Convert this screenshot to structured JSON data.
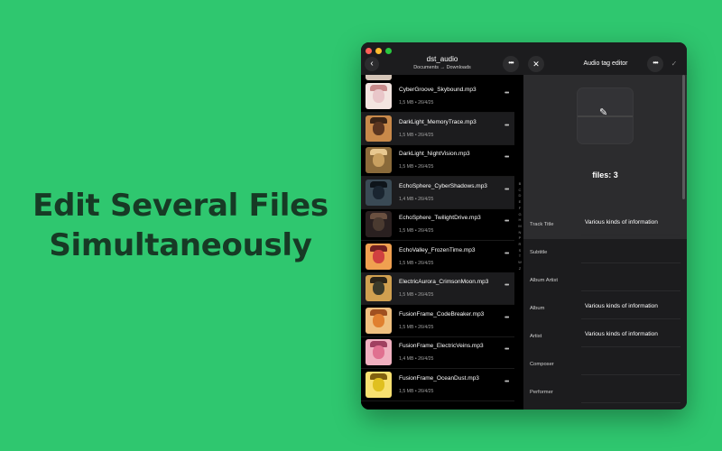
{
  "headline": {
    "line1": "Edit Several Files",
    "line2": "Simultaneously"
  },
  "colors": {
    "background": "#2fc76f",
    "headline": "#173a25",
    "window": "#1c1c1e"
  },
  "left_pane": {
    "title": "dst_audio",
    "breadcrumb": "Documents → Downloads",
    "back_icon": "chevron-left-icon",
    "more_icon": "ellipsis-icon",
    "files": [
      {
        "name": "CyberGroove_Skybound.mp3",
        "meta": "1,5 MB • 26/4/25",
        "selected": false
      },
      {
        "name": "DarkLight_MemoryTrace.mp3",
        "meta": "1,5 MB • 26/4/25",
        "selected": true
      },
      {
        "name": "DarkLight_NightVision.mp3",
        "meta": "1,5 MB • 26/4/25",
        "selected": false
      },
      {
        "name": "EchoSphere_CyberShadows.mp3",
        "meta": "1,4 MB • 26/4/25",
        "selected": true
      },
      {
        "name": "EchoSphere_TwilightDrive.mp3",
        "meta": "1,5 MB • 26/4/25",
        "selected": false
      },
      {
        "name": "EchoValley_FrozenTime.mp3",
        "meta": "1,5 MB • 26/4/25",
        "selected": false
      },
      {
        "name": "ElectricAurora_CrimsonMoon.mp3",
        "meta": "1,5 MB • 26/4/25",
        "selected": true
      },
      {
        "name": "FusionFrame_CodeBreaker.mp3",
        "meta": "1,5 MB • 26/4/25",
        "selected": false
      },
      {
        "name": "FusionFrame_ElectricVeins.mp3",
        "meta": "1,4 MB • 26/4/25",
        "selected": false
      },
      {
        "name": "FusionFrame_OceanDust.mp3",
        "meta": "1,5 MB • 26/4/25",
        "selected": false
      }
    ],
    "index_letters": [
      "B",
      "C",
      "D",
      "E",
      "F",
      "G",
      "H",
      "M",
      "N",
      "P",
      "R",
      "S",
      "T",
      "W",
      "Z"
    ]
  },
  "editor": {
    "title": "Audio tag editor",
    "close_icon": "close-icon",
    "more_icon": "ellipsis-icon",
    "confirm_icon": "checkmark-icon",
    "artwork_icon": "pencil-icon",
    "files_count": "files: 3",
    "fields": [
      {
        "label": "Track Title",
        "value": "Various kinds of information"
      },
      {
        "label": "Subtitle",
        "value": ""
      },
      {
        "label": "Album Artist",
        "value": ""
      },
      {
        "label": "Album",
        "value": "Various kinds of information"
      },
      {
        "label": "Artist",
        "value": "Various kinds of information"
      },
      {
        "label": "Composer",
        "value": ""
      },
      {
        "label": "Performer",
        "value": ""
      }
    ]
  }
}
